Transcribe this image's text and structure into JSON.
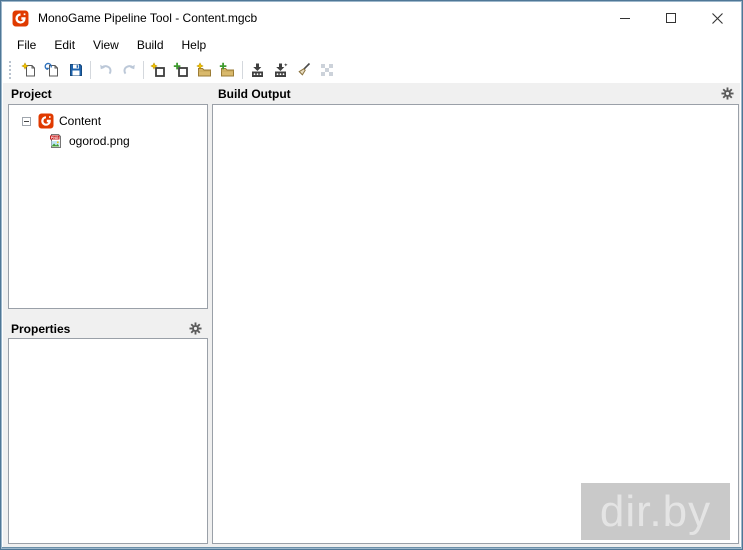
{
  "window": {
    "title": "MonoGame Pipeline Tool - Content.mgcb",
    "app_icon": "monogame-logo-icon",
    "caption_buttons": [
      "minimize",
      "maximize",
      "close"
    ]
  },
  "menu": {
    "items": [
      {
        "label": "File"
      },
      {
        "label": "Edit"
      },
      {
        "label": "View"
      },
      {
        "label": "Build"
      },
      {
        "label": "Help"
      }
    ]
  },
  "toolbar": {
    "icons": [
      {
        "name": "new-project-icon",
        "disabled": false
      },
      {
        "name": "open-project-icon",
        "disabled": false
      },
      {
        "name": "save-icon",
        "disabled": false
      },
      {
        "name": "undo-icon",
        "disabled": true
      },
      {
        "name": "redo-icon",
        "disabled": true
      },
      {
        "name": "new-item-icon",
        "disabled": false
      },
      {
        "name": "add-item-icon",
        "disabled": false
      },
      {
        "name": "new-folder-icon",
        "disabled": false
      },
      {
        "name": "add-folder-icon",
        "disabled": false
      },
      {
        "name": "build-icon",
        "disabled": false
      },
      {
        "name": "rebuild-icon",
        "disabled": false
      },
      {
        "name": "clean-icon",
        "disabled": false
      },
      {
        "name": "cancel-build-icon",
        "disabled": true
      }
    ]
  },
  "panels": {
    "project": {
      "title": "Project",
      "tree": {
        "root": {
          "label": "Content",
          "icon": "monogame-logo-icon",
          "expanded": true
        },
        "children": [
          {
            "label": "ogorod.png",
            "icon": "png-file-icon"
          }
        ]
      }
    },
    "properties": {
      "title": "Properties",
      "content": ""
    },
    "build_output": {
      "title": "Build Output",
      "content": ""
    }
  },
  "watermark": {
    "text": "dir.by"
  },
  "colors": {
    "window_border": "#4f7796",
    "content_background": "#f0f0f0",
    "panel_border": "#9aa0a8",
    "brand_orange": "#e03a00",
    "save_blue": "#1e63ad",
    "folder_tan": "#d9b96c",
    "watermark_bg": "#c9c9c9",
    "watermark_text": "#e4e4e4"
  }
}
